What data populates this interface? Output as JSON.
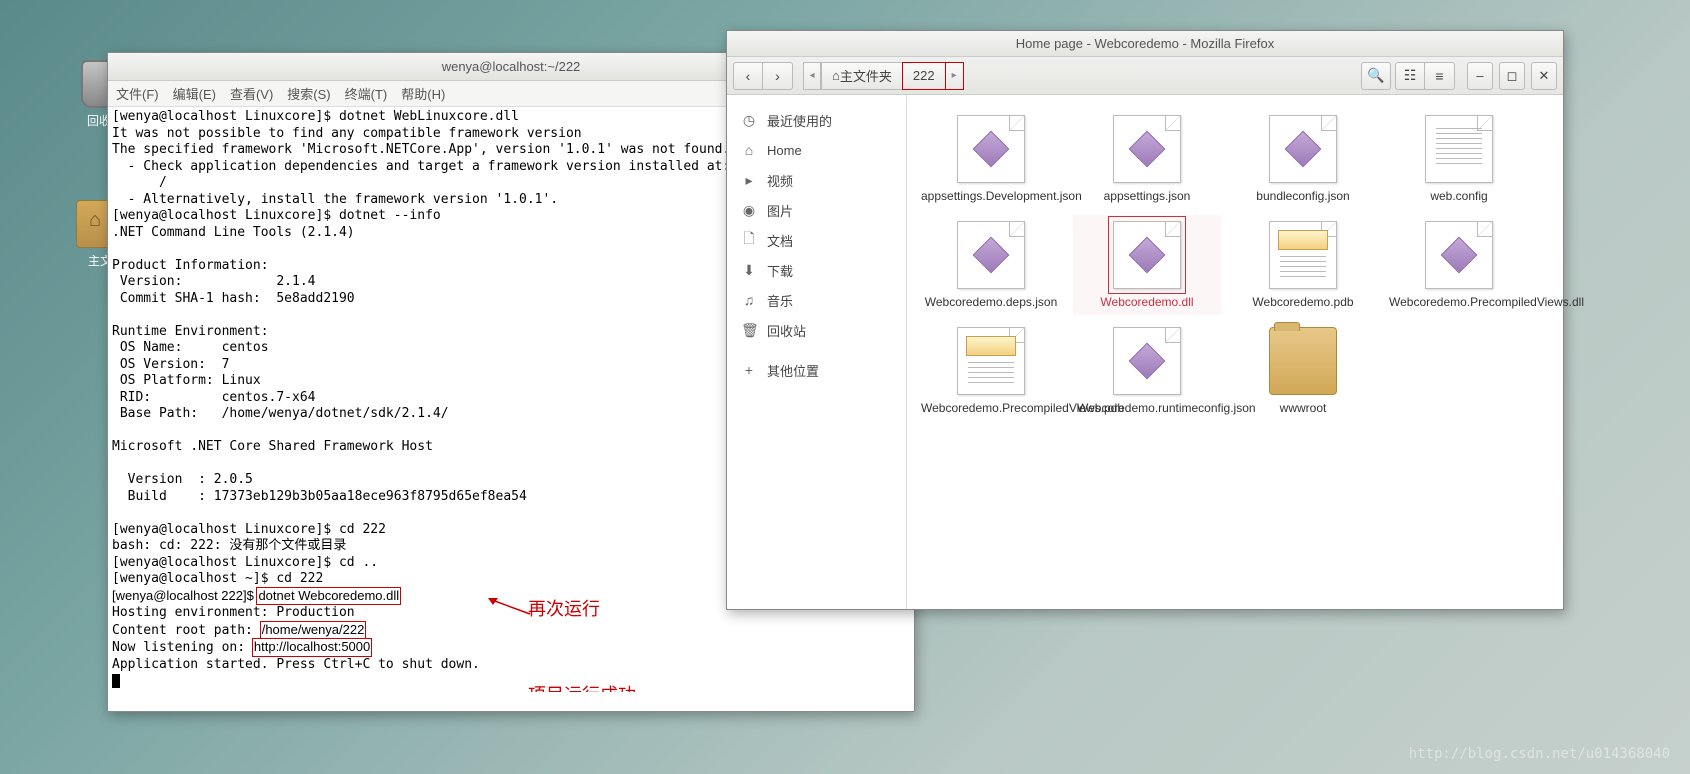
{
  "desktop": {
    "trash_label": "回收站",
    "folder_label": "主文"
  },
  "terminal": {
    "title": "wenya@localhost:~/222",
    "menu": [
      "文件(F)",
      "编辑(E)",
      "查看(V)",
      "搜索(S)",
      "终端(T)",
      "帮助(H)"
    ],
    "lines": [
      "[wenya@localhost Linuxcore]$ dotnet WebLinuxcore.dll",
      "It was not possible to find any compatible framework version",
      "The specified framework 'Microsoft.NETCore.App', version '1.0.1' was not found.",
      "  - Check application dependencies and target a framework version installed at:",
      "      /",
      "  - Alternatively, install the framework version '1.0.1'.",
      "[wenya@localhost Linuxcore]$ dotnet --info",
      ".NET Command Line Tools (2.1.4)",
      "",
      "Product Information:",
      " Version:            2.1.4",
      " Commit SHA-1 hash:  5e8add2190",
      "",
      "Runtime Environment:",
      " OS Name:     centos",
      " OS Version:  7",
      " OS Platform: Linux",
      " RID:         centos.7-x64",
      " Base Path:   /home/wenya/dotnet/sdk/2.1.4/",
      "",
      "Microsoft .NET Core Shared Framework Host",
      "",
      "  Version  : 2.0.5",
      "  Build    : 17373eb129b3b05aa18ece963f8795d65ef8ea54",
      "",
      "[wenya@localhost Linuxcore]$ cd 222",
      "bash: cd: 222: 没有那个文件或目录",
      "[wenya@localhost Linuxcore]$ cd ..",
      "[wenya@localhost ~]$ cd 222"
    ],
    "cmd_line_prefix": "[wenya@localhost 222]$ ",
    "cmd_highlight": "dotnet Webcoredemo.dll",
    "out1": "Hosting environment: Production",
    "out2_prefix": "Content root path: ",
    "out2_hl": "/home/wenya/222",
    "out3_prefix": "Now listening on: ",
    "out3_hl": "http://localhost:5000",
    "out4": "Application started. Press Ctrl+C to shut down.",
    "anno1": "再次运行",
    "anno2": "项目运行成功"
  },
  "fm": {
    "title": "Home page - Webcoredemo - Mozilla Firefox",
    "bc_home": "主文件夹",
    "bc_cur": "222",
    "side": [
      {
        "ic": "◷",
        "t": "最近使用的"
      },
      {
        "ic": "⌂",
        "t": "Home"
      },
      {
        "ic": "▸",
        "t": "视频"
      },
      {
        "ic": "◉",
        "t": "图片"
      },
      {
        "ic": "🗋",
        "t": "文档"
      },
      {
        "ic": "⬇",
        "t": "下载"
      },
      {
        "ic": "♫",
        "t": "音乐"
      },
      {
        "ic": "🗑",
        "t": "回收站"
      },
      {
        "ic": "+",
        "t": "其他位置"
      }
    ],
    "files": [
      {
        "n": "appsettings.Development.json",
        "t": "gem"
      },
      {
        "n": "appsettings.json",
        "t": "gem"
      },
      {
        "n": "bundleconfig.json",
        "t": "gem"
      },
      {
        "n": "web.config",
        "t": "txt"
      },
      {
        "n": "Webcoredemo.deps.json",
        "t": "gem"
      },
      {
        "n": "Webcoredemo.dll",
        "t": "gem",
        "sel": true
      },
      {
        "n": "Webcoredemo.pdb",
        "t": "img"
      },
      {
        "n": "Webcoredemo.PrecompiledViews.dll",
        "t": "gem"
      },
      {
        "n": "Webcoredemo.PrecompiledViews.pdb",
        "t": "img"
      },
      {
        "n": "Webcoredemo.runtimeconfig.json",
        "t": "gem"
      },
      {
        "n": "wwwroot",
        "t": "folder"
      }
    ]
  },
  "watermark": "http://blog.csdn.net/u014368040"
}
